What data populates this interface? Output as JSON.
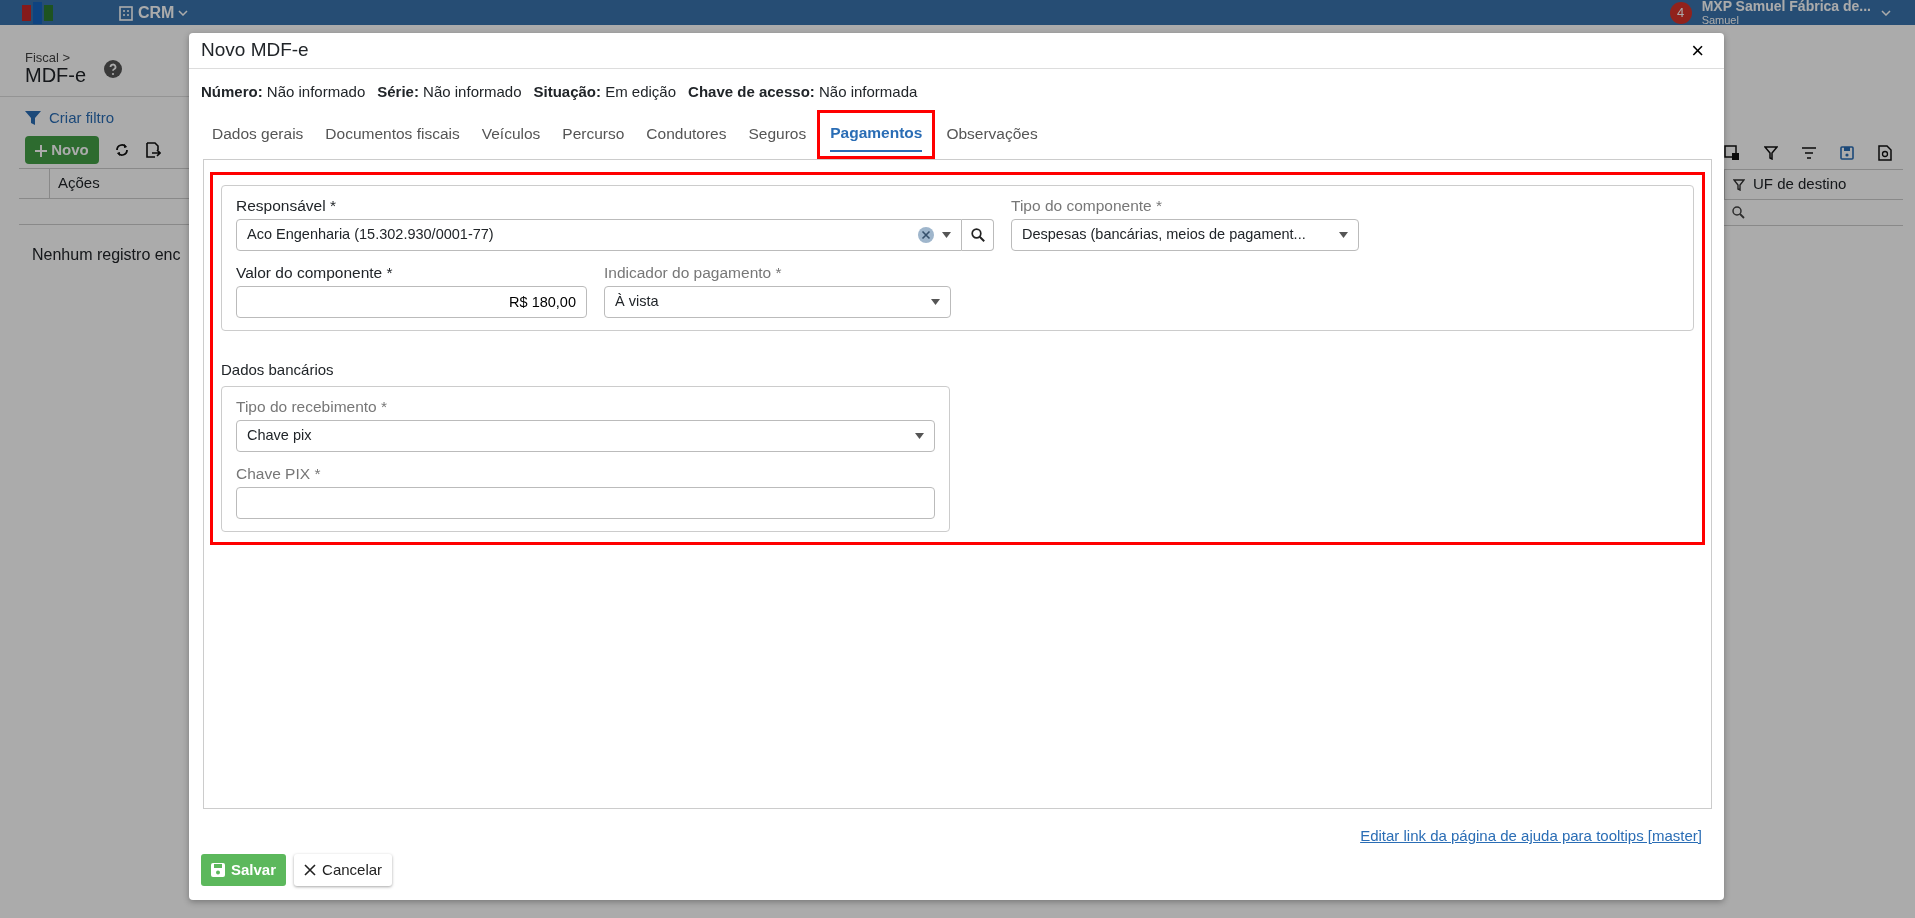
{
  "topbar": {
    "menu": [
      {
        "label": "CRM"
      }
    ],
    "notification_count": "4",
    "user": {
      "name": "MXP Samuel Fábrica de...",
      "subtitle": "Samuel"
    }
  },
  "page": {
    "breadcrumb": "Fiscal >",
    "title": "MDF-e",
    "filter_link": "Criar filtro",
    "new_button": "Novo",
    "left_columns": [
      "Ações"
    ],
    "empty_message": "Nenhum registro enc",
    "right_columns": [
      "UF de destino"
    ]
  },
  "modal": {
    "title": "Novo MDF-e",
    "close_symbol": "×",
    "info": [
      "**Número:** Não informado",
      "**Série:** Não informado",
      "**Situação:** Em edição",
      "**Chave de acesso:** Não informada"
    ],
    "tabs": [
      {
        "label": "Dados gerais",
        "selected": false,
        "highlighted": false
      },
      {
        "label": "Documentos fiscais",
        "selected": false,
        "highlighted": false
      },
      {
        "label": "Veículos",
        "selected": false,
        "highlighted": false
      },
      {
        "label": "Percurso",
        "selected": false,
        "highlighted": false
      },
      {
        "label": "Condutores",
        "selected": false,
        "highlighted": false
      },
      {
        "label": "Seguros",
        "selected": false,
        "highlighted": false
      },
      {
        "label": "Pagamentos",
        "selected": true,
        "highlighted": true
      },
      {
        "label": "Observações",
        "selected": false,
        "highlighted": false
      }
    ],
    "panel_highlighted": true,
    "component": {
      "responsavel": {
        "label": "Responsável *",
        "muted": false,
        "value": "Aco Engenharia (15.302.930/0001-77)"
      },
      "tipo": {
        "label": "Tipo do componente *",
        "muted": true,
        "value": "Despesas (bancárias, meios de pagament..."
      },
      "valor": {
        "label": "Valor do componente *",
        "muted": false,
        "value": "R$ 180,00"
      },
      "indicador": {
        "label": "Indicador do pagamento *",
        "muted": true,
        "value": "À vista"
      }
    },
    "bank_heading": "Dados bancários",
    "bank": {
      "tipo": {
        "label": "Tipo do recebimento *",
        "muted": true,
        "value": "Chave pix"
      },
      "chave": {
        "label": "Chave PIX *",
        "muted": true
      }
    },
    "help_link": "Editar link da página de ajuda para tooltips [master]",
    "save_button": "Salvar",
    "cancel_button": "Cancelar"
  }
}
